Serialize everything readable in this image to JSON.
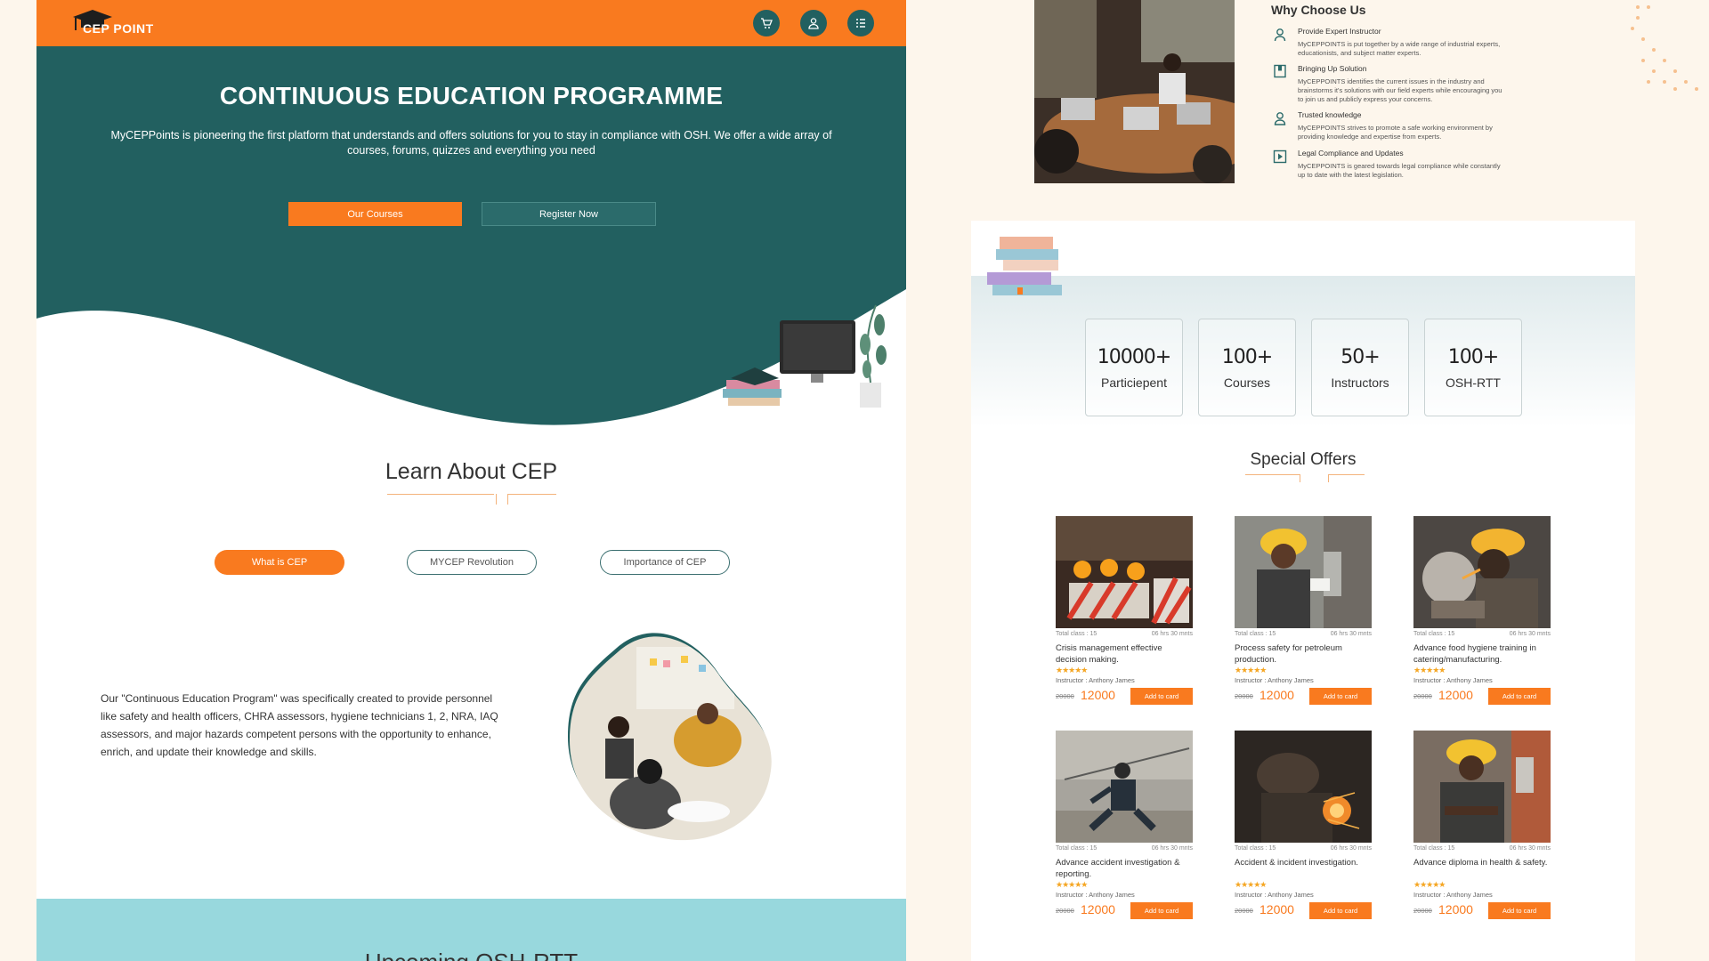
{
  "header": {
    "logo_text": "CEP POINT",
    "icons": [
      "cart-icon",
      "user-icon",
      "menu-icon"
    ]
  },
  "hero": {
    "title": "CONTINUOUS EDUCATION PROGRAMME",
    "description": "MyCEPPoints is pioneering the first platform that understands and offers solutions for you to stay in compliance with OSH. We offer a wide array of courses, forums, quizzes and everything you need",
    "btn_courses": "Our Courses",
    "btn_register": "Register Now"
  },
  "learn": {
    "title": "Learn About CEP",
    "tabs": [
      "What is CEP",
      "MYCEP Revolution",
      "Importance of CEP"
    ],
    "active_tab": 0,
    "text": "Our \"Continuous Education Program\" was specifically created to provide personnel like safety and health officers, CHRA assessors, hygiene technicians 1, 2, NRA, IAQ assessors, and major hazards competent persons with the opportunity to enhance, enrich, and update their knowledge and skills."
  },
  "upcoming": {
    "title": "Upcoming OSH-RTT"
  },
  "why": {
    "title": "Why Choose Us",
    "items": [
      {
        "icon": "instructor-icon",
        "heading": "Provide Expert Instructor",
        "desc": "MyCEPPOINTS is put together by a wide range of industrial experts, educationists, and subject matter experts."
      },
      {
        "icon": "book-icon",
        "heading": "Bringing Up Solution",
        "desc": "MyCEPPOINTS identifies the current issues in the industry and brainstorms it's solutions with our field experts while encouraging you to join us and publicly express your concerns."
      },
      {
        "icon": "knowledge-icon",
        "heading": "Trusted knowledge",
        "desc": "MyCEPPOINTS strives to promote a safe working environment by providing knowledge and expertise from experts."
      },
      {
        "icon": "play-icon",
        "heading": "Legal Compliance and Updates",
        "desc": "MyCEPPOINTS is geared towards legal compliance while constantly up to date with the latest legislation."
      }
    ]
  },
  "stats": [
    {
      "number": "10000+",
      "label": "Particiepent"
    },
    {
      "number": "100+",
      "label": "Courses"
    },
    {
      "number": "50+",
      "label": "Instructors"
    },
    {
      "number": "100+",
      "label": "OSH-RTT"
    }
  ],
  "offers": {
    "title": "Special Offers",
    "courses": [
      {
        "total": "Total class : 15",
        "hours": "06 hrs 30 mnts",
        "name": "Crisis management effective decision making.",
        "stars": "★★★★★",
        "instructor": "Instructor : Anthony James",
        "old_price": "20000",
        "price": "12000",
        "cta": "Add to card"
      },
      {
        "total": "Total class : 15",
        "hours": "06 hrs 30 mnts",
        "name": "Process safety for petroleum production.",
        "stars": "★★★★★",
        "instructor": "Instructor : Anthony James",
        "old_price": "20000",
        "price": "12000",
        "cta": "Add to card"
      },
      {
        "total": "Total class : 15",
        "hours": "06 hrs 30 mnts",
        "name": "Advance food hygiene training in catering/manufacturing.",
        "stars": "★★★★★",
        "instructor": "Instructor : Anthony James",
        "old_price": "20000",
        "price": "12000",
        "cta": "Add to card"
      },
      {
        "total": "Total class : 15",
        "hours": "06 hrs 30 mnts",
        "name": "Advance accident investigation & reporting.",
        "stars": "★★★★★",
        "instructor": "Instructor : Anthony James",
        "old_price": "20000",
        "price": "12000",
        "cta": "Add to card"
      },
      {
        "total": "Total class : 15",
        "hours": "06 hrs 30 mnts",
        "name": "Accident & incident investigation.",
        "stars": "★★★★★",
        "instructor": "Instructor : Anthony James",
        "old_price": "20000",
        "price": "12000",
        "cta": "Add to card"
      },
      {
        "total": "Total class : 15",
        "hours": "06 hrs 30 mnts",
        "name": "Advance diploma in health & safety.",
        "stars": "★★★★★",
        "instructor": "Instructor : Anthony James",
        "old_price": "20000",
        "price": "12000",
        "cta": "Add to card"
      }
    ]
  },
  "colors": {
    "brand_orange": "#f97a1f",
    "brand_teal": "#226060",
    "light_cyan": "#98d8dd"
  }
}
